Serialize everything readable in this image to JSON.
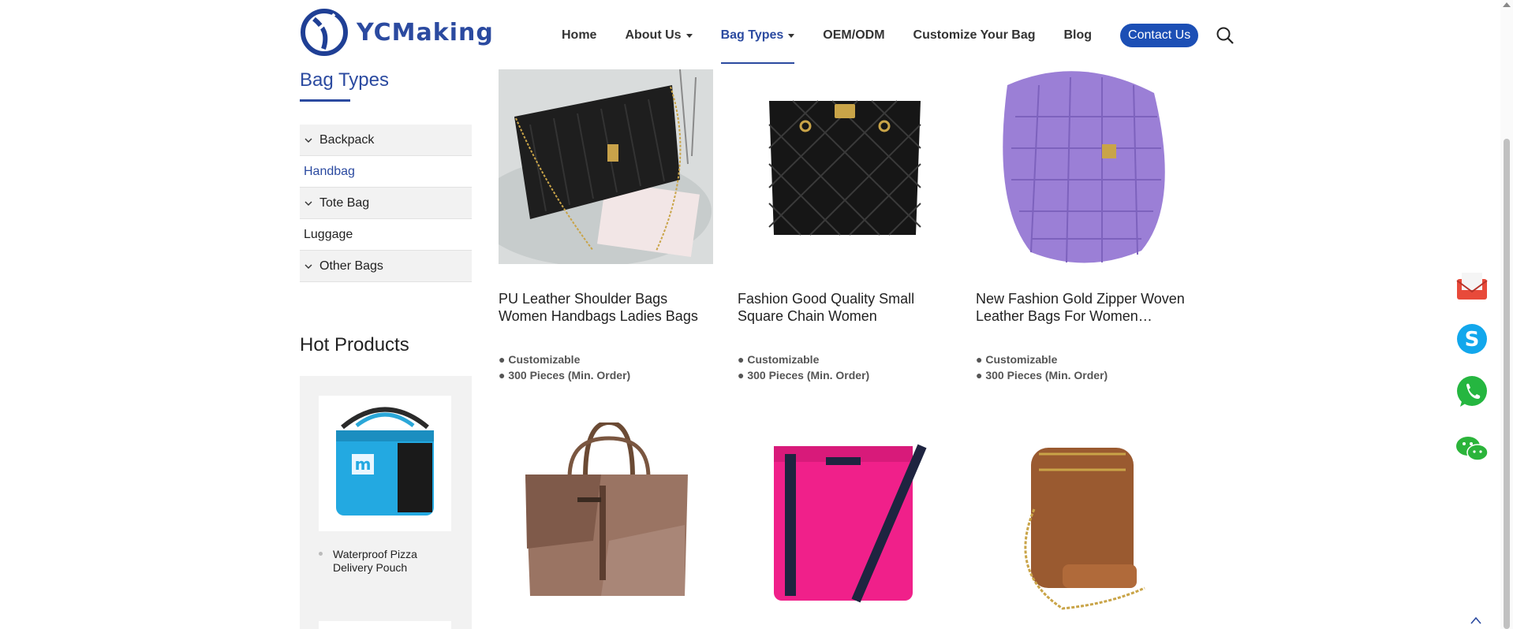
{
  "brand": {
    "name": "YCMaking",
    "color": "#2b4aa0"
  },
  "nav": {
    "items": [
      {
        "label": "Home",
        "dropdown": false,
        "active": false
      },
      {
        "label": "About Us",
        "dropdown": true,
        "active": false
      },
      {
        "label": "Bag Types",
        "dropdown": true,
        "active": true
      },
      {
        "label": "OEM/ODM",
        "dropdown": false,
        "active": false
      },
      {
        "label": "Customize Your Bag",
        "dropdown": false,
        "active": false
      },
      {
        "label": "Blog",
        "dropdown": false,
        "active": false
      }
    ],
    "contact_label": "Contact Us",
    "search_icon": "search-icon"
  },
  "sidebar": {
    "title": "Bag Types",
    "categories": [
      {
        "label": "Backpack",
        "expandable": true
      },
      {
        "label": "Handbag",
        "expandable": false,
        "current": true
      },
      {
        "label": "Tote Bag",
        "expandable": true
      },
      {
        "label": "Luggage",
        "expandable": false
      },
      {
        "label": "Other Bags",
        "expandable": true
      }
    ],
    "hot_title": "Hot Products",
    "hot_items": [
      {
        "name": "Waterproof Pizza Delivery Pouch"
      }
    ]
  },
  "products": [
    {
      "name": "PU Leather Shoulder Bags Women Handbags Ladies Bags",
      "spec1": "● Customizable",
      "spec2": "● 300 Pieces (Min. Order)"
    },
    {
      "name": "Fashion Good Quality Small Square Chain Women Handbags…",
      "spec1": "● Customizable",
      "spec2": "● 300 Pieces (Min. Order)"
    },
    {
      "name": "New Fashion Gold Zipper Woven Leather Bags For Women…",
      "spec1": "● Customizable",
      "spec2": "● 300 Pieces (Min. Order)"
    },
    {
      "name": "",
      "spec1": "",
      "spec2": ""
    },
    {
      "name": "",
      "spec1": "",
      "spec2": ""
    },
    {
      "name": "",
      "spec1": "",
      "spec2": ""
    }
  ],
  "float_icons": [
    "email-icon",
    "skype-icon",
    "whatsapp-icon",
    "wechat-icon"
  ],
  "colors": {
    "accent": "#1c4fb5",
    "purple_bag": "#9b7fd6",
    "pink_bag": "#f0208a",
    "brown_bag": "#9a5a30"
  }
}
